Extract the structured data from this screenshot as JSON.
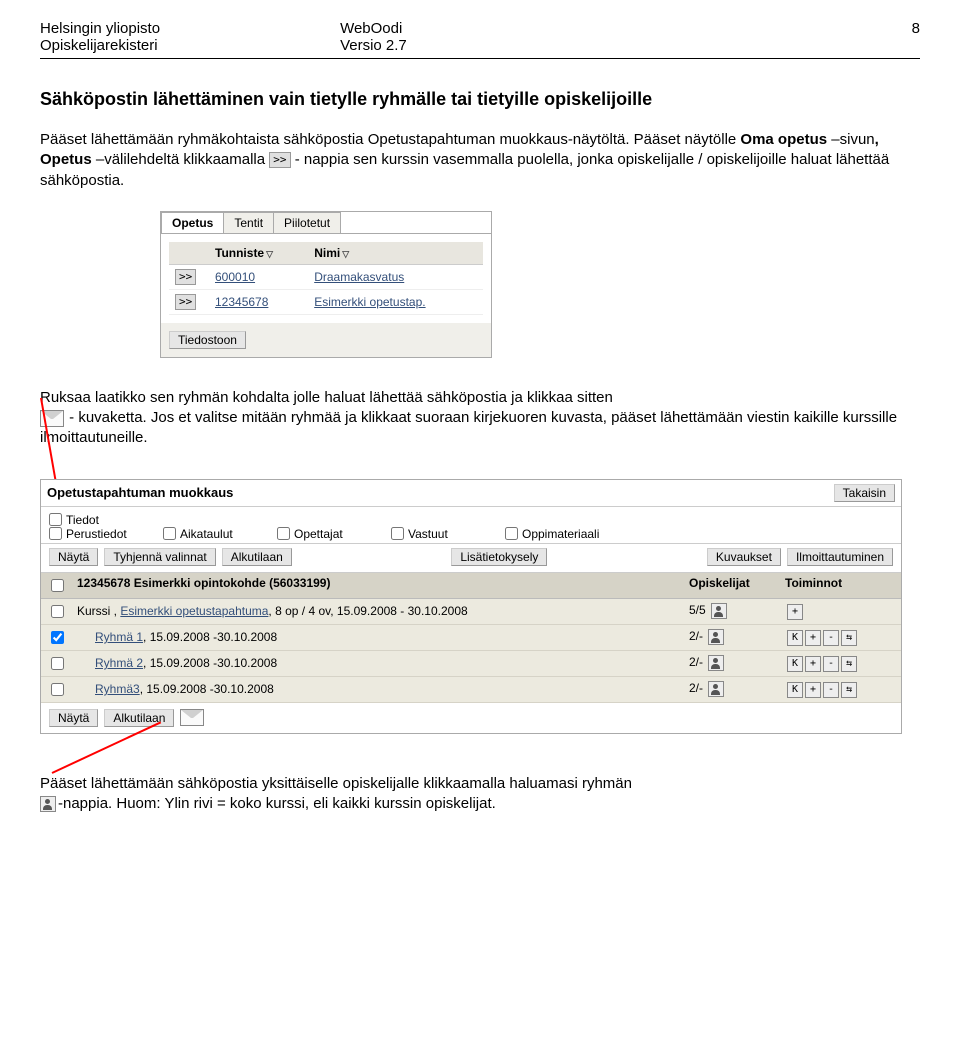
{
  "header": {
    "left1": "Helsingin yliopisto",
    "left2": "Opiskelijarekisteri",
    "center1": "WebOodi",
    "center2": "Versio 2.7",
    "right": "8"
  },
  "section_title": "Sähköpostin lähettäminen vain tietylle ryhmälle tai tietyille opiskelijoille",
  "para1_a": "Pääset lähettämään ryhmäkohtaista sähköpostia Opetustapahtuman muokkaus-näytöltä. Pääset näytölle ",
  "para1_b": "Oma opetus",
  "para1_c": " –sivun",
  "para1_d": ", Opetus",
  "para1_e": " –välilehdeltä klikkaamalla ",
  "para1_f": " - nappia sen kurssin vasemmalla puolella, jonka opiskelijalle / opiskelijoille haluat lähettää sähköpostia.",
  "btn_expand": ">>",
  "sc1": {
    "tabs": {
      "t1": "Opetus",
      "t2": "Tentit",
      "t3": "Piilotetut"
    },
    "th_code": "Tunniste",
    "th_name": "Nimi",
    "rows": [
      {
        "code": "600010",
        "name": "Draamakasvatus"
      },
      {
        "code": "12345678",
        "name": "Esimerkki opetustap."
      }
    ],
    "footer_btn": "Tiedostoon"
  },
  "para2_a": "Ruksaa laatikko sen ryhmän kohdalta jolle haluat lähettää sähköpostia ja klikkaa sitten",
  "para2_b": " - kuvaketta. Jos et valitse mitään ryhmää ja klikkaat suoraan kirjekuoren kuvasta, pääset lähettämään viestin kaikille kurssille ilmoittautuneille.",
  "sc2": {
    "title": "Opetustapahtuman muokkaus",
    "back": "Takaisin",
    "chk_tiedot": "Tiedot",
    "chk_perus": "Perustiedot",
    "chk_aika": "Aikataulut",
    "chk_opet": "Opettajat",
    "chk_vast": "Vastuut",
    "chk_oppi": "Oppimateriaali",
    "btn_nayta": "Näytä",
    "btn_tyhj": "Tyhjennä valinnat",
    "btn_alku": "Alkutilaan",
    "btn_lisa": "Lisätietokysely",
    "btn_kuva": "Kuvaukset",
    "btn_ilmo": "Ilmoittautuminen",
    "col_main": "12345678 Esimerkki opintokohde (56033199)",
    "col_opisk": "Opiskelijat",
    "col_toim": "Toiminnot",
    "row_kurssi_a": "Kurssi , ",
    "row_kurssi_b": "Esimerkki opetustapahtuma",
    "row_kurssi_c": ", 8 op / 4 ov, 15.09.2008 - 30.10.2008",
    "row_kurssi_op": "5/5",
    "row_r1_a": "Ryhmä 1",
    "row_r1_b": ", 15.09.2008 -30.10.2008",
    "row_r1_op": "2/-",
    "row_r2_a": "Ryhmä 2",
    "row_r2_b": ", 15.09.2008 -30.10.2008",
    "row_r2_op": "2/-",
    "row_r3_a": "Ryhmä3",
    "row_r3_b": ", 15.09.2008 -30.10.2008",
    "row_r3_op": "2/-",
    "btn_bottom_nayta": "Näytä",
    "btn_bottom_alku": "Alkutilaan",
    "tiny_plus": "+",
    "tiny_K": "K",
    "tiny_minus": "-"
  },
  "para3_a": "Pääset lähettämään sähköpostia yksittäiselle opiskelijalle klikkaamalla haluamasi ryhmän ",
  "para3_b": "-nappia. Huom: Ylin rivi = koko kurssi, eli kaikki kurssin opiskelijat."
}
